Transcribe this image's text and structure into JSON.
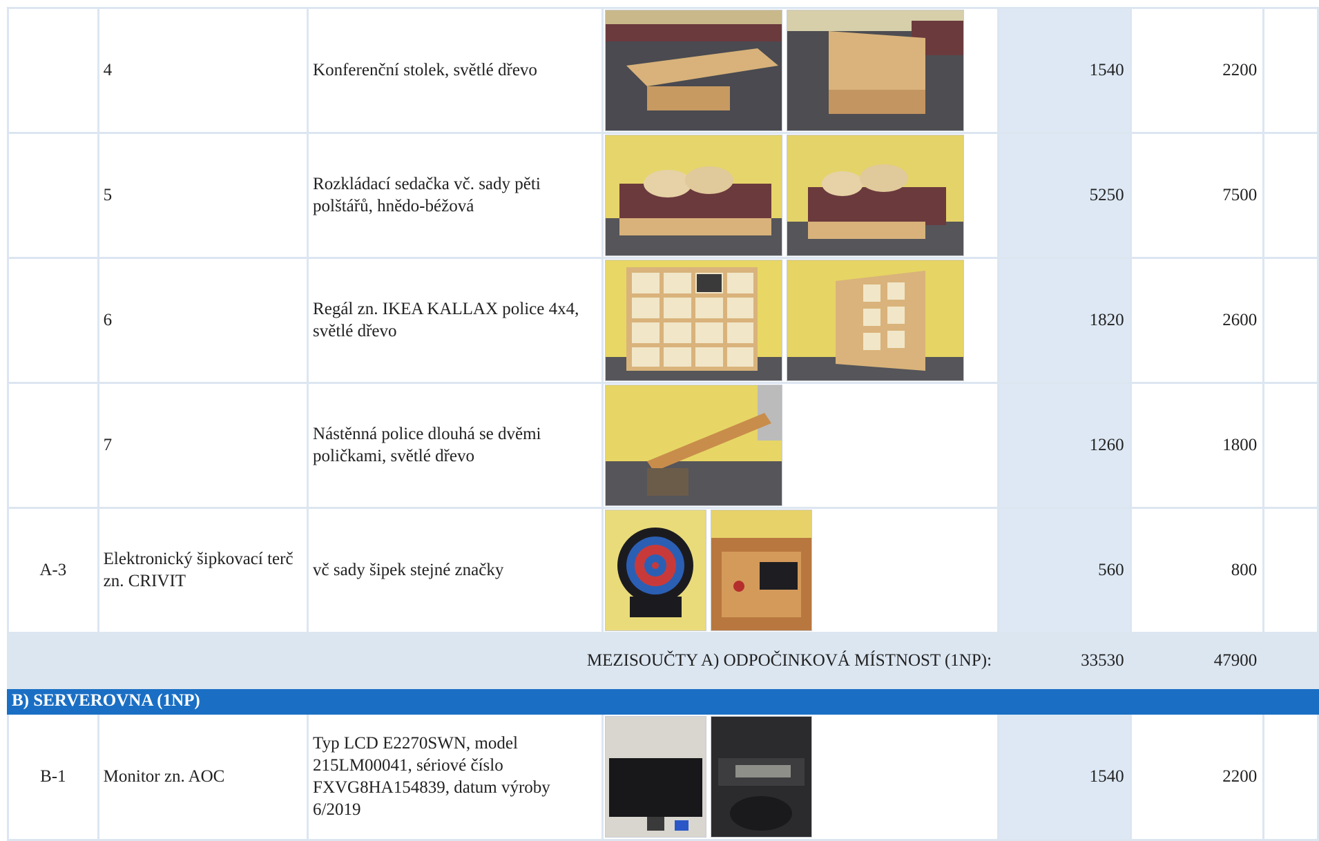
{
  "rows": [
    {
      "code": "",
      "name": "4",
      "description": "Konferenční stolek, světlé dřevo",
      "photos": [
        "coffee-table-photo-1",
        "coffee-table-photo-2"
      ],
      "value1": "1540",
      "value2": "2200"
    },
    {
      "code": "",
      "name": "5",
      "description": "Rozkládací sedačka vč. sady pěti polštářů, hnědo-béžová",
      "photos": [
        "sofa-photo-1",
        "sofa-photo-2"
      ],
      "value1": "5250",
      "value2": "7500"
    },
    {
      "code": "",
      "name": "6",
      "description": "Regál zn. IKEA KALLAX police 4x4, světlé dřevo",
      "photos": [
        "shelf-photo-1",
        "shelf-photo-2"
      ],
      "value1": "1820",
      "value2": "2600"
    },
    {
      "code": "",
      "name": "7",
      "description": "Nástěnná police dlouhá se dvěmi poličkami, světlé dřevo",
      "photos": [
        "wall-shelf-photo-1"
      ],
      "value1": "1260",
      "value2": "1800"
    },
    {
      "code": "A-3",
      "name": "Elektronický šipkovací terč zn. CRIVIT",
      "description": "vč sady šipek stejné značky",
      "photos": [
        "dartboard-photo-1",
        "dartboard-photo-2"
      ],
      "value1": "560",
      "value2": "800"
    }
  ],
  "subtotal": {
    "label": "MEZISOUČTY A) ODPOČINKOVÁ MÍSTNOST (1NP):",
    "value1": "33530",
    "value2": "47900"
  },
  "section": {
    "title": "B) SERVEROVNA (1NP)"
  },
  "rows_b": [
    {
      "code": "B-1",
      "name": "Monitor zn. AOC",
      "description": "Typ LCD E2270SWN, model 215LM00041, sériové číslo FXVG8HA154839, datum výroby 6/2019",
      "photos": [
        "monitor-photo-1",
        "monitor-photo-2"
      ],
      "value1": "1540",
      "value2": "2200"
    }
  ],
  "colors": {
    "header_blue": "#1a6fc4",
    "cell_blue": "#dde8f4",
    "grid": "#dce6f1"
  }
}
